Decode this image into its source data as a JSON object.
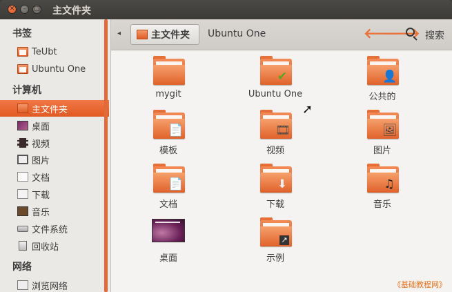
{
  "window": {
    "title": "主文件夹",
    "controls": [
      "close-icon",
      "minimize-icon",
      "maximize-icon"
    ]
  },
  "sidebar": {
    "sections": [
      {
        "header": "书签",
        "items": [
          {
            "label": "TeUbt",
            "icon": "folder-icon"
          },
          {
            "label": "Ubuntu One",
            "icon": "folder-icon"
          }
        ]
      },
      {
        "header": "计算机",
        "items": [
          {
            "label": "主文件夹",
            "icon": "home-folder-icon",
            "selected": true
          },
          {
            "label": "桌面",
            "icon": "desktop-icon"
          },
          {
            "label": "视频",
            "icon": "video-icon"
          },
          {
            "label": "图片",
            "icon": "pictures-icon"
          },
          {
            "label": "文档",
            "icon": "documents-icon"
          },
          {
            "label": "下载",
            "icon": "downloads-icon"
          },
          {
            "label": "音乐",
            "icon": "music-icon"
          },
          {
            "label": "文件系统",
            "icon": "filesystem-icon"
          },
          {
            "label": "回收站",
            "icon": "trash-icon"
          }
        ]
      },
      {
        "header": "网络",
        "items": [
          {
            "label": "浏览网络",
            "icon": "network-icon"
          }
        ]
      }
    ]
  },
  "toolbar": {
    "breadcrumb_active": "主文件夹",
    "breadcrumb_next": "Ubuntu One",
    "search_label": "搜索",
    "back_glyph": "🡐",
    "forward_glyph": "🡒"
  },
  "files": [
    {
      "label": "mygit",
      "emblem": ""
    },
    {
      "label": "Ubuntu One",
      "emblem": "✔"
    },
    {
      "label": "公共的",
      "emblem": "👤"
    },
    {
      "label": "模板",
      "emblem": "📄"
    },
    {
      "label": "视频",
      "emblem": "🎞"
    },
    {
      "label": "图片",
      "emblem": "🖼"
    },
    {
      "label": "文档",
      "emblem": "📄"
    },
    {
      "label": "下载",
      "emblem": "⬇"
    },
    {
      "label": "音乐",
      "emblem": "♫"
    },
    {
      "label": "桌面",
      "emblem": ""
    },
    {
      "label": "示例",
      "emblem": "↗"
    }
  ],
  "watermark": "《基础教程网》",
  "colors": {
    "accent": "#e8733c",
    "selection": "#e8662e",
    "content_bg": "#f4f3f1",
    "sidebar_bg": "#ebe9e6"
  }
}
